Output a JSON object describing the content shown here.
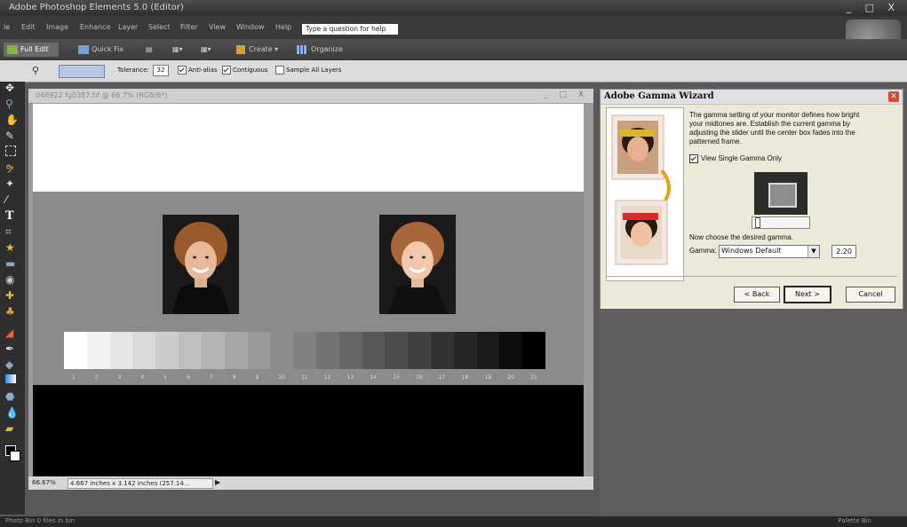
{
  "app": {
    "title": "Adobe Photoshop Elements 5.0 (Editor)",
    "window_controls": "_ □ X"
  },
  "menu": {
    "items": [
      "le",
      "Edit",
      "Image",
      "Enhance",
      "Layer",
      "Select",
      "Filter",
      "View",
      "Window",
      "Help"
    ],
    "help_search_placeholder": "Type a question for help"
  },
  "modes": {
    "full_edit": "Full Edit",
    "quick_fix": "Quick Fix",
    "create": "Create ▾",
    "organize": "Organize"
  },
  "options": {
    "tolerance_label": "Tolerance:",
    "tolerance_value": "32",
    "anti_alias": "Anti-alias",
    "contiguous": "Contiguous",
    "sample_all_layers": "Sample All Layers",
    "anti_alias_checked": true,
    "contiguous_checked": true,
    "sample_all_checked": false
  },
  "document": {
    "title": "048922 fg0387.tif @ 66.7% (RGB/8*)",
    "controls": "_ □ X",
    "zoom": "66.67%",
    "dimensions": "4.667 inches x 3.142 inches (257.14..."
  },
  "graybar": {
    "numbers": [
      "1",
      "2",
      "3",
      "4",
      "5",
      "6",
      "7",
      "8",
      "9",
      "10",
      "11",
      "12",
      "13",
      "14",
      "15",
      "16",
      "17",
      "18",
      "19",
      "20",
      "21"
    ]
  },
  "dialog": {
    "title": "Adobe Gamma Wizard",
    "description": "The gamma setting of your monitor defines how bright your midtones are. Establish the current gamma by adjusting the slider until the center box fades into the patterned frame.",
    "view_single_label": "View Single Gamma Only",
    "choose_prompt": "Now choose the desired gamma.",
    "gamma_label": "Gamma:",
    "gamma_option": "Windows Default",
    "gamma_value": "2.20",
    "back_button": "< Back",
    "next_button": "Next >",
    "cancel_button": "Cancel"
  },
  "bottom": {
    "left": "Photo Bin   0 files in bin",
    "right": "Palette Bin"
  }
}
